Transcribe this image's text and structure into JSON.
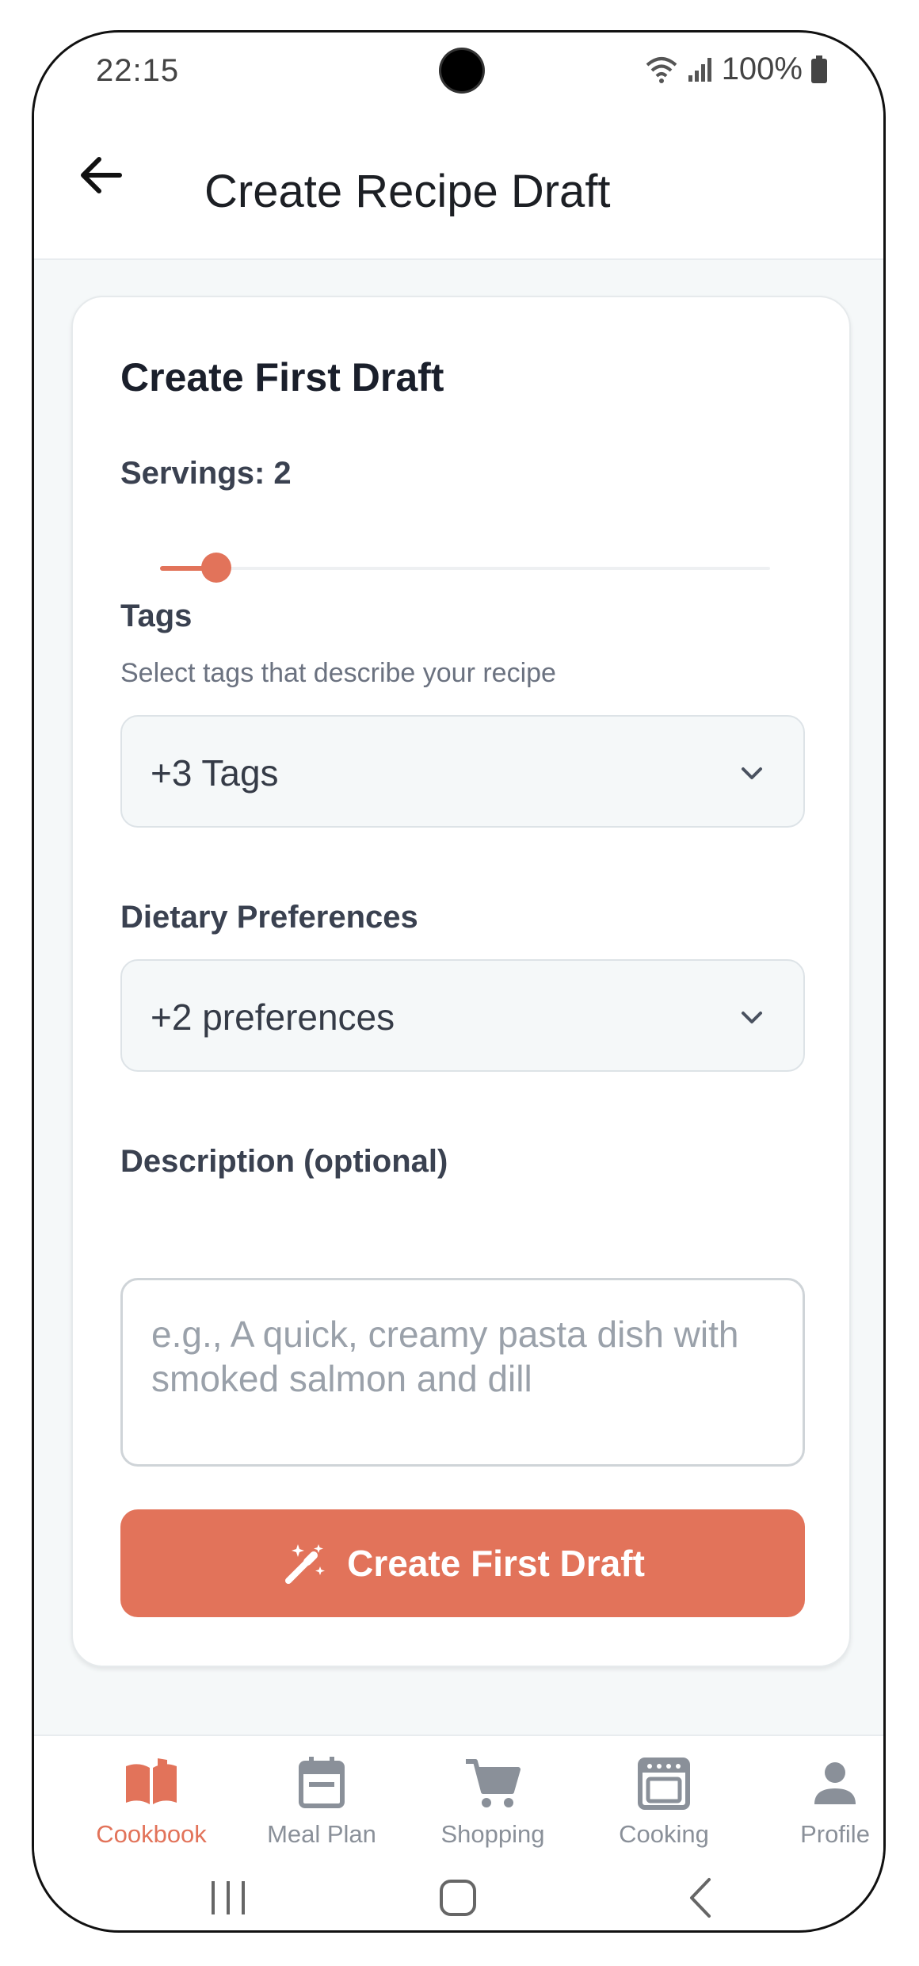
{
  "status_bar": {
    "time": "22:15",
    "battery": "100%"
  },
  "header": {
    "title": "Create Recipe Draft"
  },
  "form": {
    "card_title": "Create First Draft",
    "servings_label": "Servings: 2",
    "servings_value": 2,
    "tags_label": "Tags",
    "tags_hint": "Select tags that describe your recipe",
    "tags_value": "+3 Tags",
    "dietary_label": "Dietary Preferences",
    "dietary_value": "+2 preferences",
    "description_label": "Description (optional)",
    "description_placeholder": "e.g., A quick, creamy pasta dish with smoked salmon and dill",
    "submit_label": "Create First Draft"
  },
  "bottom_nav": [
    {
      "label": "Cookbook",
      "icon": "book-icon",
      "active": true
    },
    {
      "label": "Meal Plan",
      "icon": "calendar-icon",
      "active": false
    },
    {
      "label": "Shopping",
      "icon": "cart-icon",
      "active": false
    },
    {
      "label": "Cooking",
      "icon": "stove-icon",
      "active": false
    },
    {
      "label": "Profile",
      "icon": "person-icon",
      "active": false
    }
  ],
  "colors": {
    "accent": "#e2735a",
    "inactive": "#8a9099",
    "text_dark": "#1a1f2b",
    "background": "#f5f8f9"
  }
}
